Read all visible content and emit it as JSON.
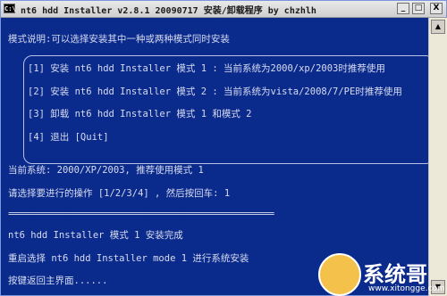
{
  "window": {
    "icon_label": "C:\\",
    "title": "nt6 hdd Installer v2.8.1 20090717 安装/卸载程序 by chzhlh",
    "buttons": {
      "minimize": "_",
      "maximize": "□",
      "close": "X"
    }
  },
  "console": {
    "mode_description": "模式说明:可以选择安装其中一种或两种模式同时安装",
    "menu": [
      "[1] 安装 nt6 hdd Installer 模式 1 : 当前系统为2000/xp/2003时推荐使用",
      "[2] 安装 nt6 hdd Installer 模式 2 : 当前系统为vista/2008/7/PE时推荐使用",
      "[3] 卸载 nt6 hdd Installer 模式 1 和模式 2",
      "[4] 退出 [Quit]"
    ],
    "current_system": "当前系统: 2000/XP/2003, 推荐使用模式 1",
    "prompt": "请选择要进行的操作 [1/2/3/4] , 然后按回车: 1",
    "separator": "==========================================================",
    "result": "nt6 hdd Installer 模式 1 安装完成",
    "reboot_note": "重启选择 nt6 hdd Installer mode 1 进行系统安装",
    "back_note": "按键返回主界面......"
  },
  "scrollbar": {
    "up": "▲",
    "down": "▼"
  },
  "watermark": {
    "text": "系统哥",
    "url": "www.xitongge.com"
  },
  "colors": {
    "console_bg": "#0a2a8c",
    "console_text": "#d8dcf0",
    "titlebar": "#d9d9d9"
  }
}
